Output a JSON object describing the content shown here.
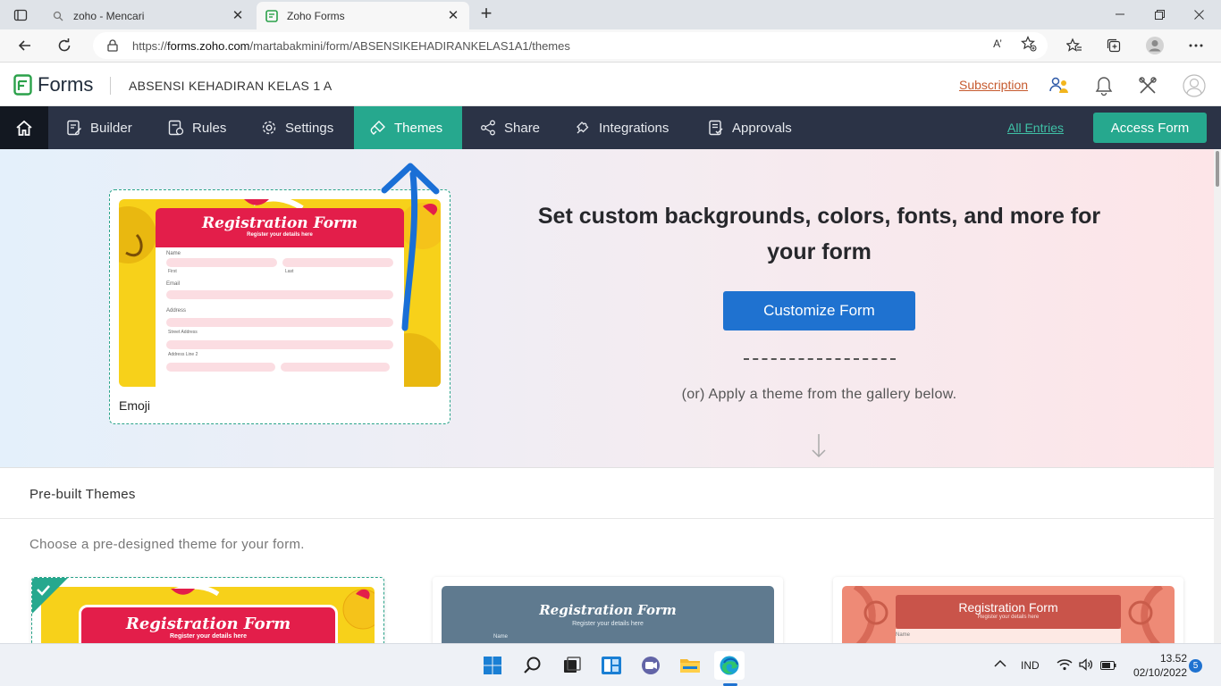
{
  "browser": {
    "tabs": [
      {
        "title": "zoho - Mencari",
        "active": false
      },
      {
        "title": "Zoho Forms",
        "active": true
      }
    ],
    "url_prefix": "https://",
    "url_domain": "forms.zoho.com",
    "url_path": "/martabakmini/form/ABSENSIKEHADIRANKELAS1A1/themes",
    "read_aloud_icon": "A’"
  },
  "header": {
    "brand": "Forms",
    "form_name": "ABSENSI KEHADIRAN KELAS 1 A",
    "subscription_label": "Subscription"
  },
  "nav": {
    "items": [
      {
        "label": "Builder",
        "icon": "builder-icon"
      },
      {
        "label": "Rules",
        "icon": "rules-icon"
      },
      {
        "label": "Settings",
        "icon": "gear-icon"
      },
      {
        "label": "Themes",
        "icon": "brush-icon",
        "active": true
      },
      {
        "label": "Share",
        "icon": "share-icon"
      },
      {
        "label": "Integrations",
        "icon": "puzzle-icon"
      },
      {
        "label": "Approvals",
        "icon": "approvals-icon"
      }
    ],
    "all_entries_label": "All Entries",
    "access_form_label": "Access Form"
  },
  "hero": {
    "current_theme_name": "Emoji",
    "title": "Set custom backgrounds, colors, fonts, and more for your form",
    "customize_label": "Customize Form",
    "subtitle": "(or) Apply a theme from the gallery below."
  },
  "preview_form": {
    "title": "Registration Form",
    "subtitle": "Register your details here",
    "labels": {
      "name": "Name",
      "first": "First",
      "last": "Last",
      "email": "Email",
      "address": "Address",
      "street": "Street Address",
      "line2": "Address Line 2"
    }
  },
  "prebuilt": {
    "heading": "Pre-built Themes",
    "description": "Choose a pre-designed theme for your form."
  },
  "taskbar": {
    "language": "IND",
    "time": "13.52",
    "date": "02/10/2022",
    "notifications": "5"
  },
  "colors": {
    "nav_bg": "#2b3346",
    "accent_green": "#26a88e",
    "primary_blue": "#1f72d0",
    "subscription": "#c65a2e",
    "form_red": "#e31e4a"
  }
}
